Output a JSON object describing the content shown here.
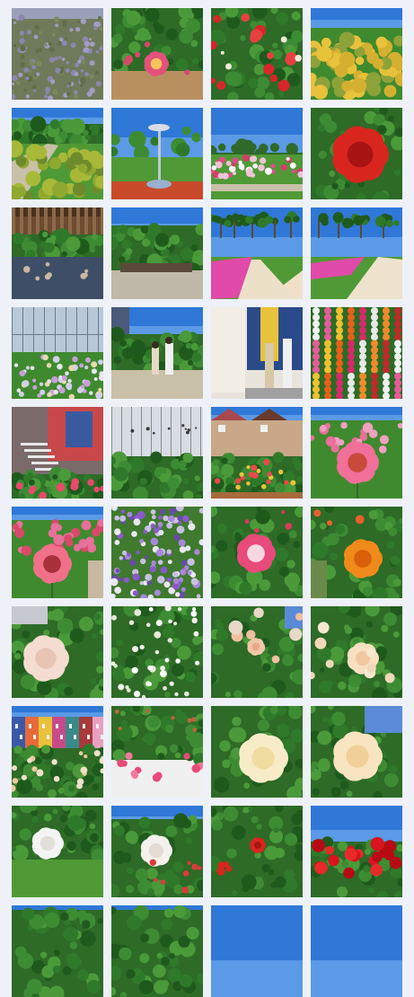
{
  "gallery": {
    "photos": [
      {
        "scene": "garden-path"
      },
      {
        "scene": "red-blossom"
      },
      {
        "scene": "topiary"
      },
      {
        "scene": "pond"
      },
      {
        "scene": "lavender-field"
      },
      {
        "scene": "pink-frangipani"
      },
      {
        "scene": "red-flower-bush"
      },
      {
        "scene": "yellow-hedge"
      },
      {
        "scene": "lawn-hedge"
      },
      {
        "scene": "fountain"
      },
      {
        "scene": "flower-beds"
      },
      {
        "scene": "red-rose"
      },
      {
        "scene": "pergola-deck"
      },
      {
        "scene": "green-arch"
      },
      {
        "scene": "palm-path-pink"
      },
      {
        "scene": "palm-path-pink-2"
      },
      {
        "scene": "greenhouse"
      },
      {
        "scene": "couple-walkway"
      },
      {
        "scene": "couple-mural"
      },
      {
        "scene": "flower-wall"
      },
      {
        "scene": "stairs-mural"
      },
      {
        "scene": "greenhouse-plants"
      },
      {
        "scene": "houses-garden"
      },
      {
        "scene": "pink-gerbera"
      },
      {
        "scene": "gerbera-field"
      },
      {
        "scene": "purple-statice"
      },
      {
        "scene": "pink-rose"
      },
      {
        "scene": "orange-rose"
      },
      {
        "scene": "white-rose"
      },
      {
        "scene": "white-flower-bush"
      },
      {
        "scene": "peach-roses"
      },
      {
        "scene": "cream-roses"
      },
      {
        "scene": "colorful-buildings"
      },
      {
        "scene": "pink-buds"
      },
      {
        "scene": "cream-rose"
      },
      {
        "scene": "cream-rose-2"
      },
      {
        "scene": "white-rose-lawn"
      },
      {
        "scene": "white-rose-sky"
      },
      {
        "scene": "red-rose-bush"
      },
      {
        "scene": "red-roses-sky"
      },
      {
        "scene": "trees"
      },
      {
        "scene": "trees-2"
      },
      {
        "scene": "sky"
      },
      {
        "scene": "sky-2"
      }
    ]
  },
  "palette": {
    "background": "#eef1f8",
    "sky": "#2f78d8",
    "leaf": "#2f7a2a",
    "grass": "#4f9a36"
  }
}
